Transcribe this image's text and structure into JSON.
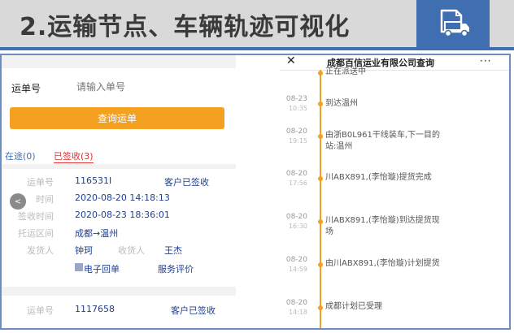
{
  "banner": {
    "title": "2.运输节点、车辆轨迹可视化",
    "icon": "truck-document-icon",
    "colors": {
      "band": "#d9d9d9",
      "accent": "#3f6fb1"
    }
  },
  "left_panel": {
    "search": {
      "label": "运单号",
      "placeholder": "请输入单号",
      "button": "查询运单"
    },
    "tabs": [
      {
        "label": "在途(0)"
      },
      {
        "label": "已签收(3)"
      }
    ],
    "order1": {
      "waybill_label": "运单号",
      "waybill_no": "116531I",
      "status": "客户已签收",
      "ship_time_label": "时间",
      "ship_time": "2020-08-20 14:18:13",
      "sign_time_label": "签收时间",
      "sign_time": "2020-08-23 18:36:01",
      "route_label": "托运区间",
      "route": "成都→温州",
      "sender_label": "发货人",
      "sender": "钟珂",
      "receiver_label": "收货人",
      "receiver": "王杰",
      "e_receipt": "电子回单",
      "review": "服务评价"
    },
    "order2": {
      "waybill_label": "运单号",
      "waybill_no": "1117658",
      "status": "客户已签收"
    }
  },
  "right_panel": {
    "title": "成都百信运业有限公司查询",
    "close_icon": "close-icon",
    "more": "···",
    "events": [
      {
        "date": "",
        "time": "",
        "text": "正在派送中"
      },
      {
        "date": "08-23",
        "time": "10:35",
        "text": "到达温州"
      },
      {
        "date": "08-20",
        "time": "19:15",
        "text": "由浙B0L961干线装车,下一目的站:温州"
      },
      {
        "date": "08-20",
        "time": "17:56",
        "text": "川ABX891,(李怡璇)提货完成"
      },
      {
        "date": "08-20",
        "time": "16:30",
        "text": "川ABX891,(李怡璇)到达提货现场"
      },
      {
        "date": "08-20",
        "time": "14:59",
        "text": "由川ABX891,(李怡璇)计划提货"
      },
      {
        "date": "08-20",
        "time": "14:18",
        "text": "成都计划已受理"
      }
    ],
    "accent": "#f4a020"
  }
}
